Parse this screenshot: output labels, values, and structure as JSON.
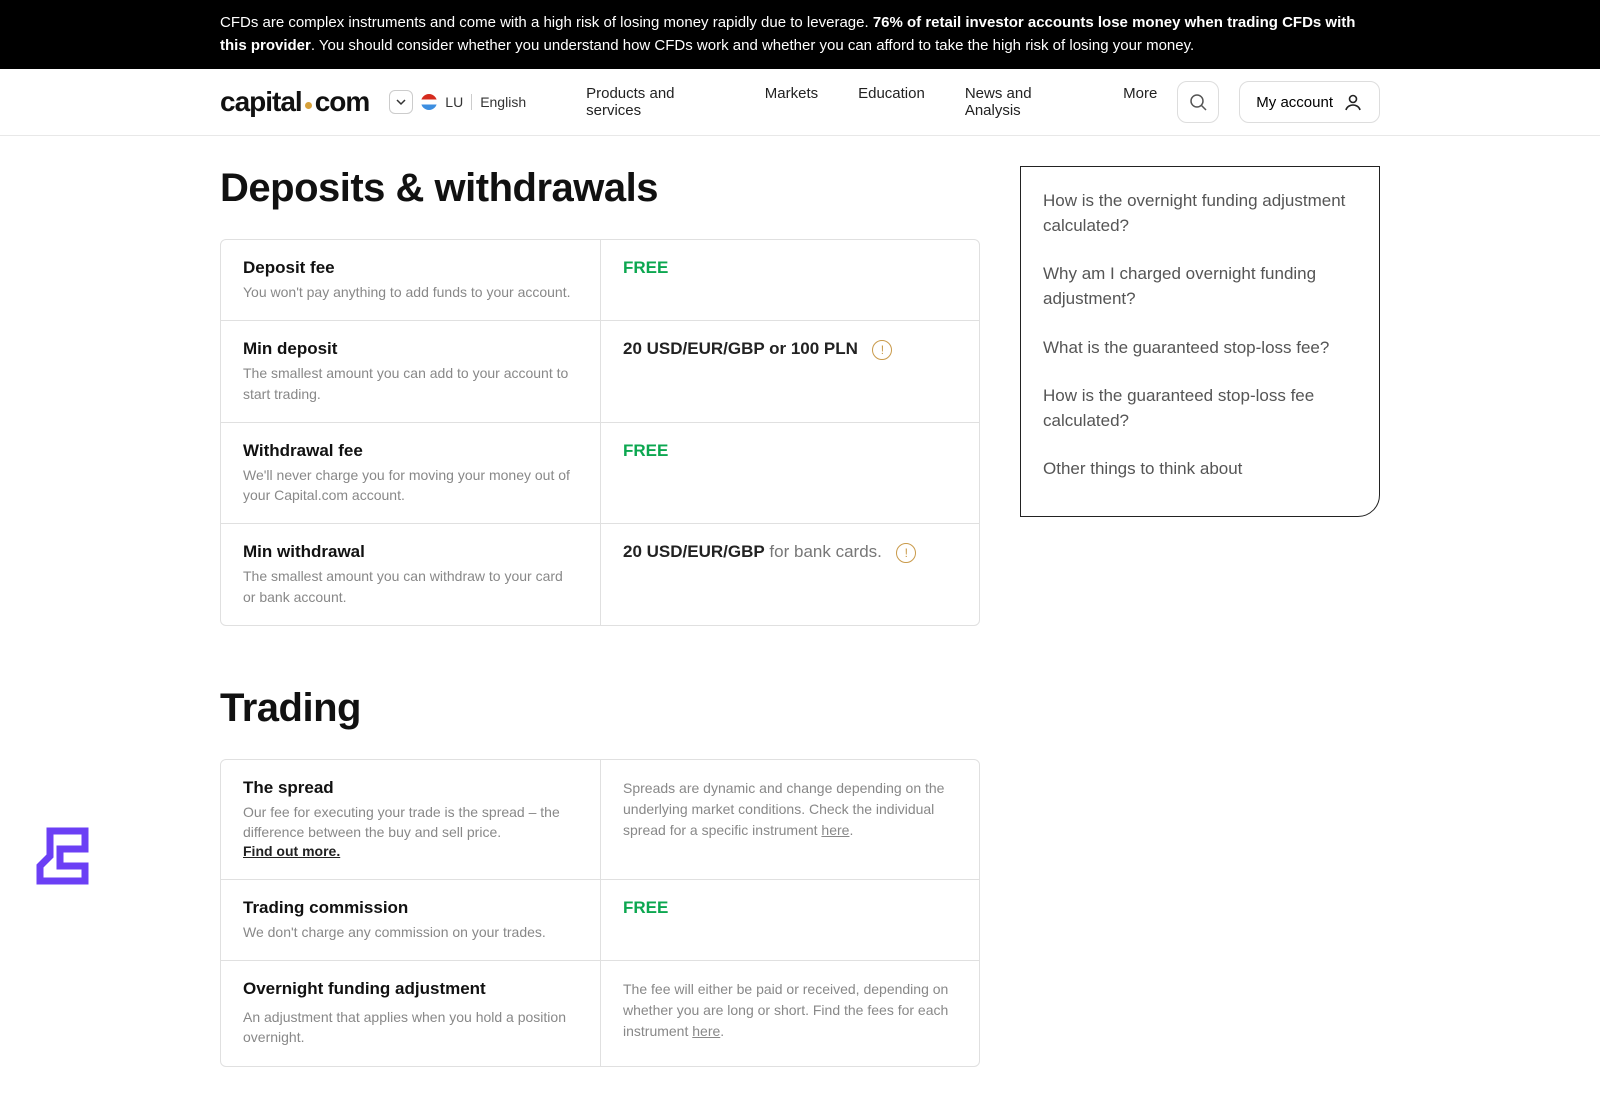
{
  "risk": {
    "p1": "CFDs are complex instruments and come with a high risk of losing money rapidly due to leverage. ",
    "bold": "76% of retail investor accounts lose money when trading CFDs with this provider",
    "p2": ". You should consider whether you understand how CFDs work and whether you can afford to take the high risk of losing your money."
  },
  "logo": {
    "a": "capital",
    "b": "com"
  },
  "locale": {
    "country": "LU",
    "language": "English"
  },
  "nav": [
    "Products and services",
    "Markets",
    "Education",
    "News and Analysis",
    "More"
  ],
  "account": "My account",
  "sections": {
    "deposits": {
      "title": "Deposits & withdrawals",
      "rows": [
        {
          "label": "Deposit fee",
          "desc": "You won't pay anything to add funds to your account.",
          "value_type": "free",
          "value": "FREE"
        },
        {
          "label": "Min deposit",
          "desc": "The smallest amount you can add to your account to start trading.",
          "value_type": "bold",
          "value": "20 USD/EUR/GBP or 100 PLN",
          "info": true
        },
        {
          "label": "Withdrawal fee",
          "desc": "We'll never charge you for moving your money out of your Capital.com account.",
          "value_type": "free",
          "value": "FREE"
        },
        {
          "label": "Min withdrawal",
          "desc": "The smallest amount you can withdraw to your card or bank account.",
          "value_type": "bold_suffix",
          "value": "20 USD/EUR/GBP",
          "suffix": " for bank cards.",
          "info": true
        }
      ]
    },
    "trading": {
      "title": "Trading",
      "rows": [
        {
          "label": "The spread",
          "desc": "Our fee for executing your trade is the spread – the difference between the buy and sell price.",
          "extra_link": "Find out more.",
          "value_type": "desc_link",
          "value_desc_pre": "Spreads are dynamic and change depending on the underlying market conditions. Check the individual spread for a specific instrument ",
          "value_link": "here",
          "value_desc_post": "."
        },
        {
          "label": "Trading commission",
          "desc": "We don't charge any commission on your trades.",
          "value_type": "free",
          "value": "FREE"
        },
        {
          "label": "Overnight funding adjustment",
          "desc": "An adjustment that applies when you hold a position overnight.",
          "value_type": "desc_link",
          "value_desc_pre": "The fee will either be paid or received, depending on whether you are long or short. Find the fees for each instrument ",
          "value_link": "here",
          "value_desc_post": "."
        }
      ]
    }
  },
  "sidebar": [
    "How is the overnight funding adjustment calculated?",
    "Why am I charged overnight funding adjustment?",
    "What is the guaranteed stop-loss fee?",
    "How is the guaranteed stop-loss fee calculated?",
    "Other things to think about"
  ]
}
